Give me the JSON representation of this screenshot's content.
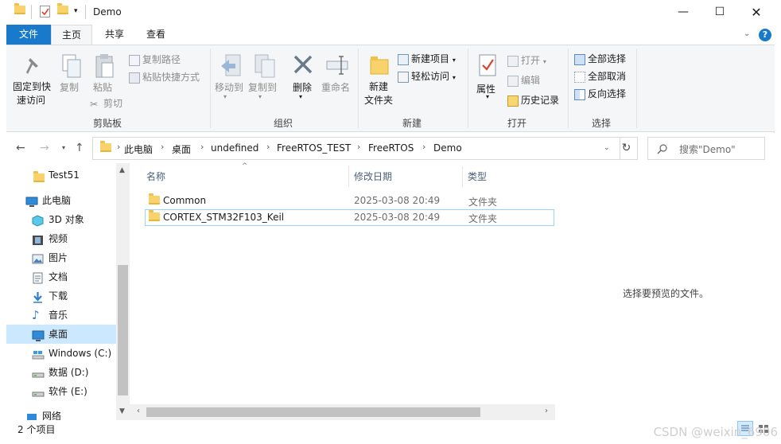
{
  "window": {
    "title": "Demo"
  },
  "tabs": {
    "file": "文件",
    "home": "主页",
    "share": "共享",
    "view": "查看"
  },
  "ribbon": {
    "clipboard": {
      "pin": "固定到快速访问",
      "pin_l1": "固定到快",
      "pin_l2": "速访问",
      "copy": "复制",
      "paste": "粘贴",
      "copy_path": "复制路径",
      "paste_shortcut": "粘贴快捷方式",
      "cut": "剪切",
      "label": "剪贴板"
    },
    "organize": {
      "move_to": "移动到",
      "copy_to": "复制到",
      "delete": "删除",
      "rename": "重命名",
      "label": "组织"
    },
    "new": {
      "new_folder_l1": "新建",
      "new_folder_l2": "文件夹",
      "new_item": "新建项目",
      "easy_access": "轻松访问",
      "label": "新建"
    },
    "open": {
      "properties": "属性",
      "open": "打开",
      "edit": "编辑",
      "history": "历史记录",
      "label": "打开"
    },
    "select": {
      "select_all": "全部选择",
      "select_none": "全部取消",
      "invert": "反向选择",
      "label": "选择"
    }
  },
  "address": {
    "crumbs": [
      "此电脑",
      "桌面",
      "undefined",
      "FreeRTOS_TEST",
      "FreeRTOS",
      "Demo"
    ],
    "search_placeholder": "搜索\"Demo\""
  },
  "nav": {
    "items": [
      {
        "label": "Test51",
        "icon": "folder-icon"
      },
      {
        "label": "此电脑",
        "icon": "computer-icon"
      },
      {
        "label": "3D 对象",
        "icon": "3d-objects-icon"
      },
      {
        "label": "视频",
        "icon": "video-icon"
      },
      {
        "label": "图片",
        "icon": "pictures-icon"
      },
      {
        "label": "文档",
        "icon": "documents-icon"
      },
      {
        "label": "下载",
        "icon": "download-icon"
      },
      {
        "label": "音乐",
        "icon": "music-icon"
      },
      {
        "label": "桌面",
        "icon": "desktop-icon"
      },
      {
        "label": "Windows (C:)",
        "icon": "drive-c-icon"
      },
      {
        "label": "数据 (D:)",
        "icon": "drive-icon"
      },
      {
        "label": "软件 (E:)",
        "icon": "drive-icon"
      },
      {
        "label": "网络",
        "icon": "network-icon"
      }
    ]
  },
  "columns": {
    "name": "名称",
    "modified": "修改日期",
    "type": "类型"
  },
  "files": [
    {
      "name": "Common",
      "modified": "2025-03-08 20:49",
      "type": "文件夹"
    },
    {
      "name": "CORTEX_STM32F103_Keil",
      "modified": "2025-03-08 20:49",
      "type": "文件夹"
    }
  ],
  "preview": {
    "text": "选择要预览的文件。"
  },
  "status": {
    "count": "2 个项目"
  },
  "watermark": "CSDN @weixin_6906"
}
